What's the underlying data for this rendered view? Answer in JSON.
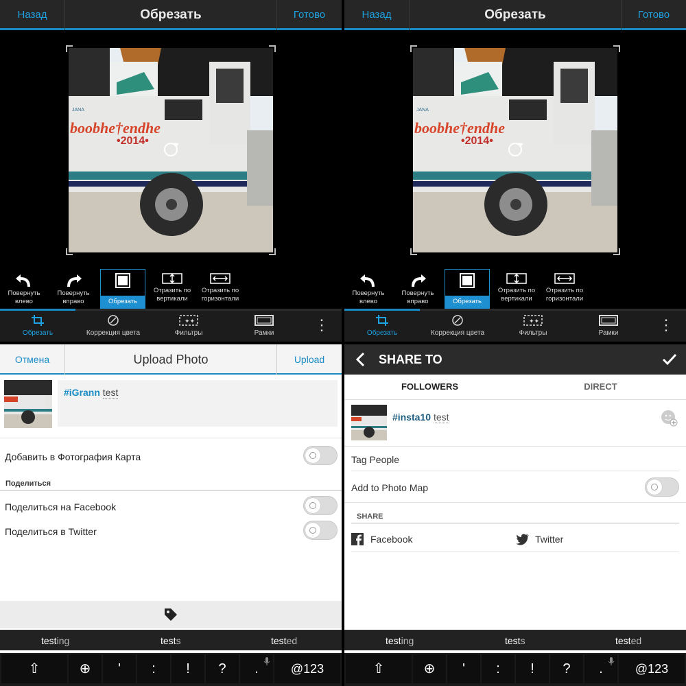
{
  "crop_screen_left": {
    "back_label": "Назад",
    "title": "Обрезать",
    "done_label": "Готово",
    "tools": [
      "Повернуть влево",
      "Повернуть вправо",
      "Обрезать",
      "Отразить по вертикали",
      "Отразить по горизонтали"
    ],
    "tabs": [
      "Обрезать",
      "Коррекция цвета",
      "Фильтры",
      "Рамки"
    ],
    "more_label": "⋮"
  },
  "crop_screen_right": {
    "back_label": "Назад",
    "title": "Обрезать",
    "done_label": "Готово",
    "tools": [
      "Повернуть влево",
      "Повернуть вправо",
      "Обрезать",
      "Отразить по вертикали",
      "Отразить по горизонтали"
    ],
    "tabs": [
      "Обрезать",
      "Коррекция цвета",
      "Фильтры",
      "Рамки"
    ],
    "more_label": "⋮"
  },
  "photo": {
    "vehicle_text_1": "JANA",
    "vehicle_text_2": "boobhe†endhe",
    "vehicle_text_3": "•2014•"
  },
  "upload_photo": {
    "cancel_label": "Отмена",
    "title": "Upload Photo",
    "upload_label": "Upload",
    "caption_tag": "#iGrann",
    "caption_text": "test",
    "add_to_map": "Добавить в Фотография Карта",
    "share_header": "Поделиться",
    "share_facebook": "Поделиться на Facebook",
    "share_twitter": "Поделиться в Twitter"
  },
  "share_to": {
    "title": "SHARE TO",
    "tab_followers": "FOLLOWERS",
    "tab_direct": "DIRECT",
    "caption_tag": "#insta10",
    "caption_text": "test",
    "tag_people": "Tag People",
    "add_to_map": "Add to Photo Map",
    "share_header": "SHARE",
    "facebook": "Facebook",
    "twitter": "Twitter"
  },
  "keyboard": {
    "suggestions": [
      {
        "bold": "test",
        "rest": "ing"
      },
      {
        "bold": "test",
        "rest": "s"
      },
      {
        "bold": "test",
        "rest": "ed"
      }
    ],
    "keys": [
      "'",
      ":",
      "!",
      "?",
      "."
    ],
    "sym_label": "@123"
  },
  "colors": {
    "accent": "#1c8ac2",
    "link": "#1a8cc7"
  }
}
